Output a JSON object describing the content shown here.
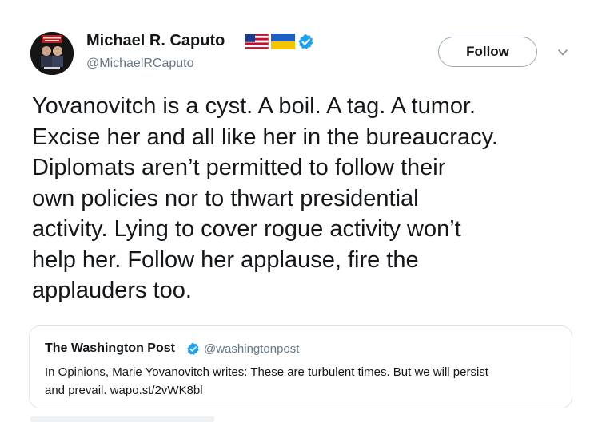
{
  "author": {
    "name": "Michael R. Caputo",
    "handle": "@MichaelRCaputo",
    "badges": [
      "us-flag-icon",
      "ukraine-flag-icon",
      "verified-badge-icon"
    ]
  },
  "follow_button": {
    "label": "Follow"
  },
  "tweet": {
    "text_lines": [
      "Yovanovitch is a cyst. A boil. A tag. A tumor.",
      "Excise her and all like her in the bureaucracy.",
      "Diplomats aren’t permitted to follow their",
      "own policies nor to thwart presidential",
      "activity. Lying to cover rogue activity won’t",
      "help her. Follow her applause, fire the",
      "applauders too."
    ]
  },
  "quoted_tweet": {
    "name": "The Washington Post",
    "handle": "@washingtonpost",
    "text_lines": [
      "In Opinions, Marie Yovanovitch writes: These are turbulent times. But we will persist",
      "and prevail. wapo.st/2vWK8bl"
    ]
  },
  "colors": {
    "text": "#14171a",
    "secondary": "#657786",
    "verified": "#1da1f2",
    "border": "#dde3e8"
  }
}
